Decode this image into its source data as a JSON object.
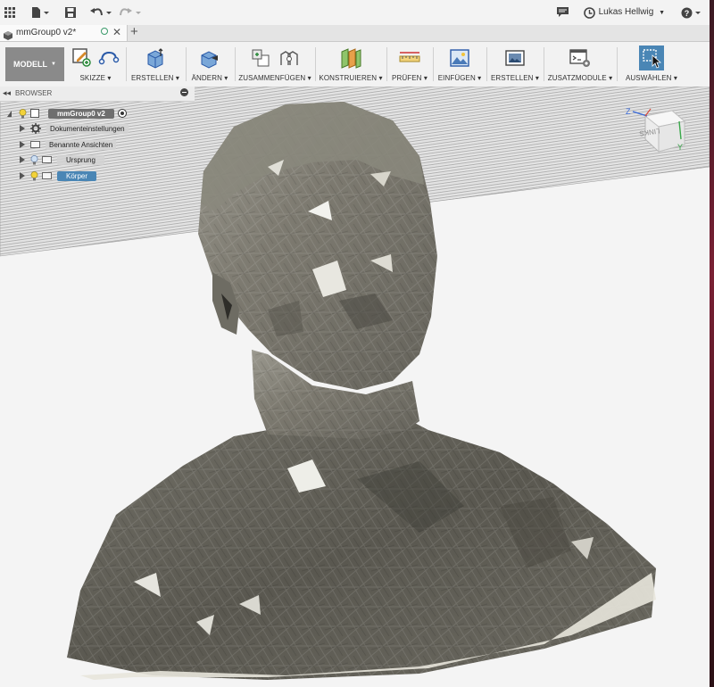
{
  "window": {
    "user_name": "Lukas Hellwig"
  },
  "tab": {
    "title": "mmGroup0 v2*"
  },
  "toolbar": {
    "workspace": "MODELL",
    "groups": [
      {
        "label": "SKIZZE"
      },
      {
        "label": "ERSTELLEN"
      },
      {
        "label": "ÄNDERN"
      },
      {
        "label": "ZUSAMMENFÜGEN"
      },
      {
        "label": "KONSTRUIEREN"
      },
      {
        "label": "PRÜFEN"
      },
      {
        "label": "EINFÜGEN"
      },
      {
        "label": "ERSTELLEN"
      },
      {
        "label": "ZUSATZMODULE"
      },
      {
        "label": "AUSWÄHLEN"
      }
    ]
  },
  "browser": {
    "title": "BROWSER",
    "root": "mmGroup0 v2",
    "items": [
      {
        "label": "Dokumenteinstellungen"
      },
      {
        "label": "Benannte Ansichten"
      },
      {
        "label": "Ursprung"
      },
      {
        "label": "Körper"
      }
    ]
  },
  "viewcube": {
    "face": "LINKS",
    "axis_z": "Z",
    "axis_y": "Y"
  },
  "colors": {
    "accent": "#4a86b5",
    "modell_bg": "#8a8a8a",
    "model_gray": "#7f7d74"
  }
}
